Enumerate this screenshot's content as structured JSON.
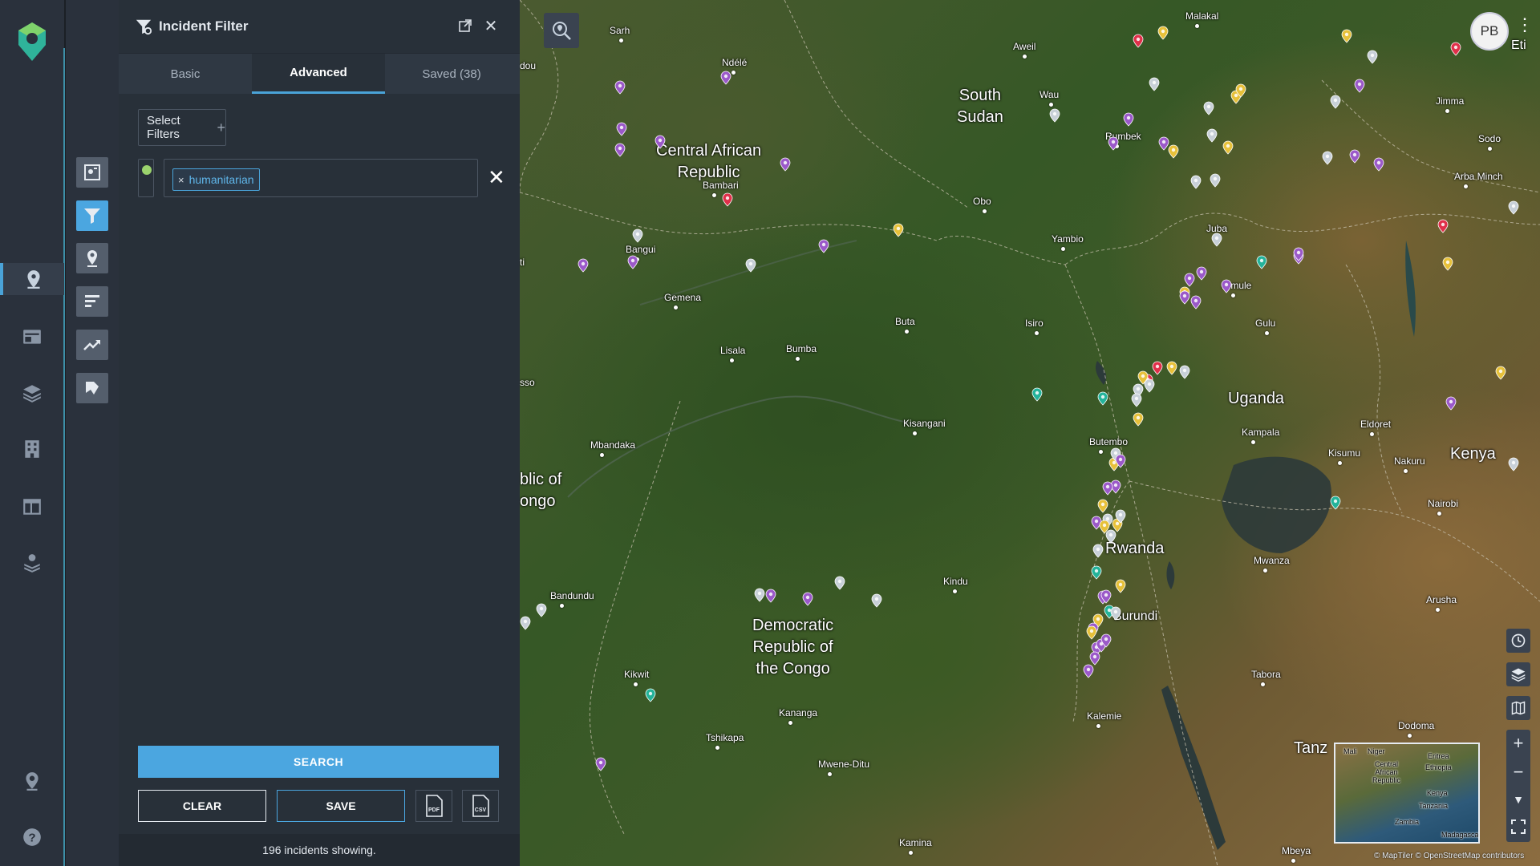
{
  "rail": {
    "items": [
      "map-pin-icon",
      "dashboard-icon",
      "layers-icon",
      "building-icon",
      "table-icon",
      "stack-pin-icon"
    ],
    "bottom": [
      "location-pin-icon",
      "help-icon"
    ]
  },
  "tools": [
    "map-report-icon",
    "incident-filter-icon",
    "location-icon",
    "bar-chart-icon",
    "trend-icon",
    "heatmap-icon"
  ],
  "panel": {
    "title": "Incident Filter",
    "tabs": [
      {
        "label": "Basic"
      },
      {
        "label": "Advanced",
        "active": true
      },
      {
        "label": "Saved (38)"
      }
    ],
    "select_filters_label": "Select Filters",
    "filter": {
      "dot_color": "#9bd36d",
      "chip_label": "humanitarian",
      "chip_remove": "×",
      "remove": "✕"
    },
    "search_label": "SEARCH",
    "clear_label": "CLEAR",
    "save_label": "SAVE",
    "pdf_label": "PDF",
    "csv_label": "CSV",
    "footer": "196 incidents showing."
  },
  "map": {
    "countries": [
      {
        "name": "South\nSudan"
      },
      {
        "name": "Central African\nRepublic"
      },
      {
        "name": "Uganda"
      },
      {
        "name": "Kenya"
      },
      {
        "name": "Rwanda"
      },
      {
        "name": "Burundi"
      },
      {
        "name": "Democratic\nRepublic of\nthe Congo"
      },
      {
        "name": "blic of\nongo"
      },
      {
        "name": "Tanz"
      }
    ],
    "cities": [
      "Sarh",
      "Ndélé",
      "Aweil",
      "Wau",
      "Rumbek",
      "Bambari",
      "Obo",
      "Yambio",
      "Bangui",
      "Gemena",
      "Buta",
      "Isiro",
      "Lisala",
      "Bumba",
      "Kisangani",
      "Mbandaka",
      "Butembo",
      "Kindu",
      "Bandundu",
      "Kikwit",
      "Kananga",
      "Tshikapa",
      "Mwene-Ditu",
      "Kamina",
      "Kalemie",
      "Kampala",
      "Gulu",
      "Nimule",
      "Juba",
      "Jimma",
      "Sodo",
      "Arba Minch",
      "Eldoret",
      "Kisumu",
      "Nakuru",
      "Nairobi",
      "Mwanza",
      "Arusha",
      "Tabora",
      "Dodoma",
      "Mbeya",
      "Malakal"
    ],
    "partial_labels": [
      "dou",
      "ti",
      "sso",
      "Eti"
    ],
    "user_initials": "PB",
    "inset_labels": [
      "Mali",
      "Niger",
      "Eritrea",
      "Ethiopia",
      "Central\nAfrican\nRepublic",
      "Kenya",
      "Tanzania",
      "Zambia",
      "Madagascar"
    ],
    "attribution": "© MapTiler © OpenStreetMap contributors",
    "marker_colors": {
      "purple": "#9b59c9",
      "yellow": "#e7c13a",
      "white": "#c8d0d8",
      "teal": "#24b39a",
      "red": "#e0304a"
    }
  }
}
